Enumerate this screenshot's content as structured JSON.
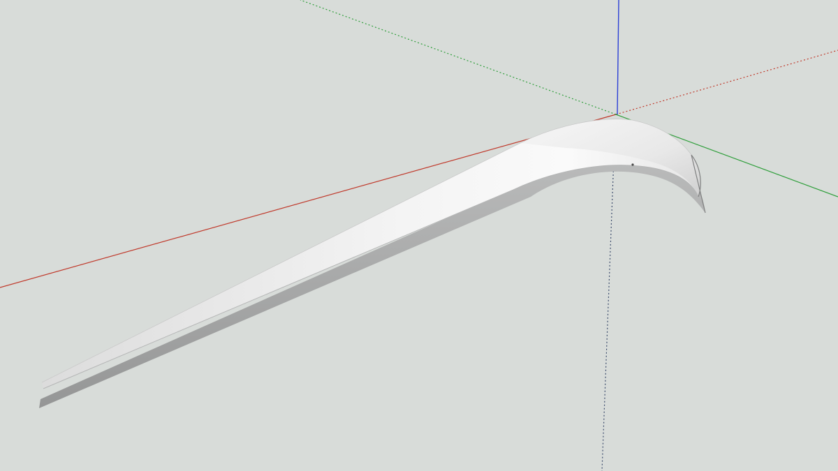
{
  "viewport": {
    "background": "#d8dcd9",
    "axes": {
      "x_axis": {
        "color": "#c0392b",
        "label": "red-axis"
      },
      "y_axis": {
        "color": "#2e9e3a",
        "label": "green-axis"
      },
      "z_axis": {
        "color": "#2b3fd6",
        "label": "blue-axis"
      }
    },
    "model": {
      "type": "3d-surface",
      "fill_light": "#f2f2f2",
      "fill_mid": "#e2e2e2",
      "fill_shade": "#a9aaa9",
      "fill_dark": "#8f9090"
    }
  }
}
